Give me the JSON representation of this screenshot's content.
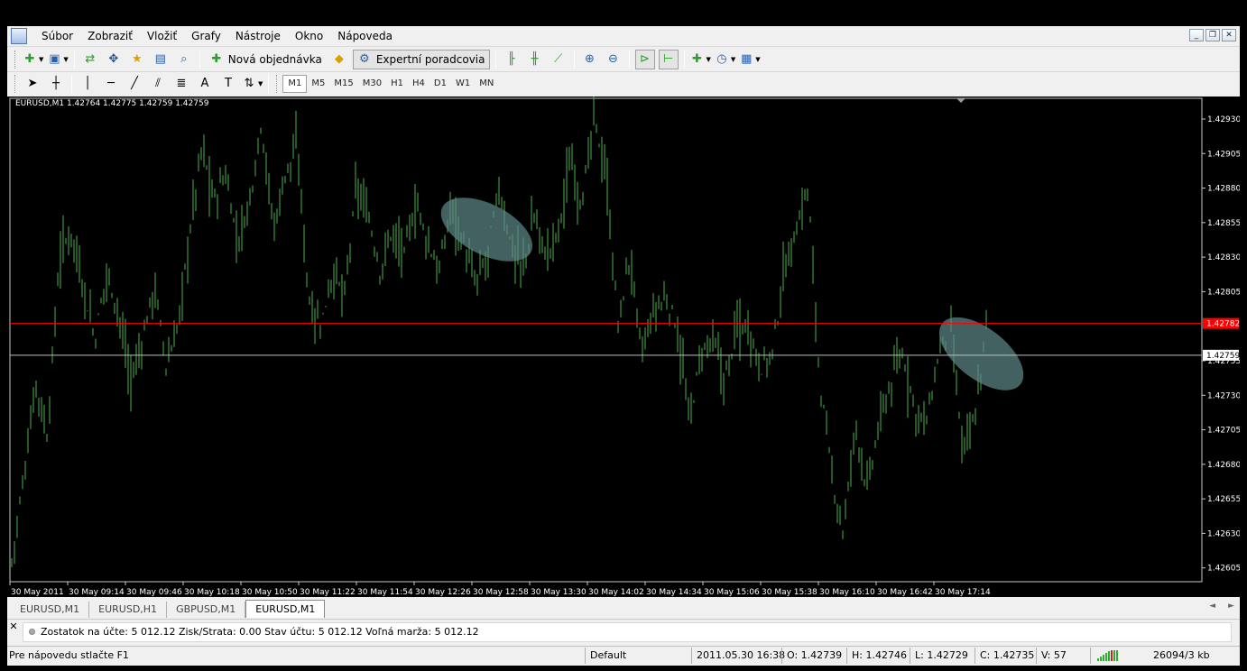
{
  "menu": [
    "Súbor",
    "Zobraziť",
    "Vložiť",
    "Grafy",
    "Nástroje",
    "Okno",
    "Nápoveda"
  ],
  "toolbar": {
    "new_order_label": "Nová objednávka",
    "expert_label": "Expertní poradcovia"
  },
  "timeframes": [
    "M1",
    "M5",
    "M15",
    "M30",
    "H1",
    "H4",
    "D1",
    "W1",
    "MN"
  ],
  "active_timeframe": "M1",
  "chart": {
    "info": "EURUSD,M1  1.42764 1.42775 1.42759 1.42759",
    "bid_label": "1.42759",
    "ask_label": "1.42782"
  },
  "chart_data": {
    "type": "ohlc-bar",
    "symbol": "EURUSD",
    "timeframe": "M1",
    "ylim": [
      1.42595,
      1.42945
    ],
    "yticks": [
      "1.42930",
      "1.42905",
      "1.42880",
      "1.42855",
      "1.42830",
      "1.42805",
      "1.42755",
      "1.42730",
      "1.42705",
      "1.42680",
      "1.42655",
      "1.42630",
      "1.42605"
    ],
    "xticks": [
      "30 May 2011",
      "30 May 09:14",
      "30 May 09:46",
      "30 May 10:18",
      "30 May 10:50",
      "30 May 11:22",
      "30 May 11:54",
      "30 May 12:26",
      "30 May 12:58",
      "30 May 13:30",
      "30 May 14:02",
      "30 May 14:34",
      "30 May 15:06",
      "30 May 15:38",
      "30 May 16:10",
      "30 May 16:42",
      "30 May 17:14"
    ],
    "price_path": [
      1.4261,
      1.4267,
      1.4274,
      1.427,
      1.4283,
      1.4285,
      1.4281,
      1.4277,
      1.4282,
      1.4279,
      1.4274,
      1.4277,
      1.4281,
      1.4275,
      1.4278,
      1.4285,
      1.4291,
      1.4287,
      1.4289,
      1.4284,
      1.4287,
      1.4293,
      1.4285,
      1.4289,
      1.4291,
      1.428,
      1.4278,
      1.4282,
      1.428,
      1.4288,
      1.4286,
      1.4282,
      1.4285,
      1.4283,
      1.4287,
      1.4284,
      1.4282,
      1.4287,
      1.4284,
      1.4281,
      1.4283,
      1.4288,
      1.4284,
      1.4282,
      1.4286,
      1.4283,
      1.4285,
      1.429,
      1.4287,
      1.4293,
      1.4289,
      1.4278,
      1.4283,
      1.4276,
      1.4279,
      1.428,
      1.4278,
      1.4271,
      1.4276,
      1.4277,
      1.4274,
      1.4278,
      1.4278,
      1.4275,
      1.4276,
      1.4282,
      1.4285,
      1.4288,
      1.4274,
      1.4267,
      1.4263,
      1.4271,
      1.4266,
      1.4271,
      1.4274,
      1.4276,
      1.4272,
      1.4271,
      1.4276,
      1.4278,
      1.4269,
      1.4271,
      1.4278
    ],
    "markers": [
      {
        "x_fraction": 0.4,
        "price": 1.4285
      },
      {
        "x_fraction": 0.815,
        "price": 1.4276
      }
    ],
    "ask_price": 1.42782,
    "bid_price": 1.42759
  },
  "tabs": [
    "EURUSD,M1",
    "EURUSD,H1",
    "GBPUSD,M1",
    "EURUSD,M1"
  ],
  "active_tab": 3,
  "terminal": {
    "text": "Zostatok na účte: 5 012.12  Zisk/Strata: 0.00  Stav účtu: 5 012.12  Voľná marža: 5 012.12"
  },
  "status": {
    "help": "Pre nápovedu stlačte F1",
    "profile": "Default",
    "datetime": "2011.05.30 16:38",
    "open": "O: 1.42739",
    "high": "H: 1.42746",
    "low": "L: 1.42729",
    "close": "C: 1.42735",
    "volume": "V: 57",
    "traffic": "26094/3 kb"
  },
  "colors": {
    "chart_bg": "#000000",
    "bars": "#4caf50",
    "ask_line": "#ff0000",
    "bid_line": "#c0c0c0",
    "marker": "#5f8a8a"
  }
}
